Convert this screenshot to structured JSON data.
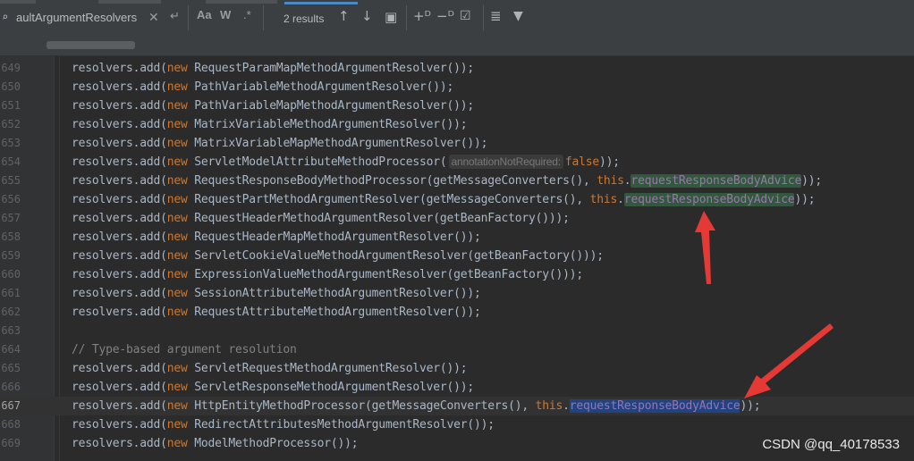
{
  "find": {
    "query": "aultArgumentResolvers",
    "results": "2 results",
    "match_case": "Aa",
    "whole_word": "W",
    "regex": ".*"
  },
  "editor": {
    "lines": [
      {
        "n": "649",
        "parts": [
          [
            "plain",
            "resolvers.add("
          ],
          [
            "kw",
            "new"
          ],
          [
            "plain",
            " RequestParamMapMethodArgumentResolver());"
          ]
        ]
      },
      {
        "n": "650",
        "parts": [
          [
            "plain",
            "resolvers.add("
          ],
          [
            "kw",
            "new"
          ],
          [
            "plain",
            " PathVariableMethodArgumentResolver());"
          ]
        ]
      },
      {
        "n": "651",
        "parts": [
          [
            "plain",
            "resolvers.add("
          ],
          [
            "kw",
            "new"
          ],
          [
            "plain",
            " PathVariableMapMethodArgumentResolver());"
          ]
        ]
      },
      {
        "n": "652",
        "parts": [
          [
            "plain",
            "resolvers.add("
          ],
          [
            "kw",
            "new"
          ],
          [
            "plain",
            " MatrixVariableMethodArgumentResolver());"
          ]
        ]
      },
      {
        "n": "653",
        "parts": [
          [
            "plain",
            "resolvers.add("
          ],
          [
            "kw",
            "new"
          ],
          [
            "plain",
            " MatrixVariableMapMethodArgumentResolver());"
          ]
        ]
      },
      {
        "n": "654",
        "parts": [
          [
            "plain",
            "resolvers.add("
          ],
          [
            "kw",
            "new"
          ],
          [
            "plain",
            " ServletModelAttributeMethodProcessor("
          ],
          [
            "hint",
            "annotationNotRequired:"
          ],
          [
            "kw",
            "false"
          ],
          [
            "plain",
            "));"
          ]
        ]
      },
      {
        "n": "655",
        "parts": [
          [
            "plain",
            "resolvers.add("
          ],
          [
            "kw",
            "new"
          ],
          [
            "plain",
            " RequestResponseBodyMethodProcessor(getMessageConverters(), "
          ],
          [
            "kw",
            "this"
          ],
          [
            "plain",
            "."
          ],
          [
            "fldhl",
            "requestResponseBodyAdvice"
          ],
          [
            "plain",
            "));"
          ]
        ]
      },
      {
        "n": "656",
        "parts": [
          [
            "plain",
            "resolvers.add("
          ],
          [
            "kw",
            "new"
          ],
          [
            "plain",
            " RequestPartMethodArgumentResolver(getMessageConverters(), "
          ],
          [
            "kw",
            "this"
          ],
          [
            "plain",
            "."
          ],
          [
            "fldhl",
            "requestResponseBodyAdvice"
          ],
          [
            "plain",
            "));"
          ]
        ]
      },
      {
        "n": "657",
        "parts": [
          [
            "plain",
            "resolvers.add("
          ],
          [
            "kw",
            "new"
          ],
          [
            "plain",
            " RequestHeaderMethodArgumentResolver(getBeanFactory()));"
          ]
        ]
      },
      {
        "n": "658",
        "parts": [
          [
            "plain",
            "resolvers.add("
          ],
          [
            "kw",
            "new"
          ],
          [
            "plain",
            " RequestHeaderMapMethodArgumentResolver());"
          ]
        ]
      },
      {
        "n": "659",
        "parts": [
          [
            "plain",
            "resolvers.add("
          ],
          [
            "kw",
            "new"
          ],
          [
            "plain",
            " ServletCookieValueMethodArgumentResolver(getBeanFactory()));"
          ]
        ]
      },
      {
        "n": "660",
        "parts": [
          [
            "plain",
            "resolvers.add("
          ],
          [
            "kw",
            "new"
          ],
          [
            "plain",
            " ExpressionValueMethodArgumentResolver(getBeanFactory()));"
          ]
        ]
      },
      {
        "n": "661",
        "parts": [
          [
            "plain",
            "resolvers.add("
          ],
          [
            "kw",
            "new"
          ],
          [
            "plain",
            " SessionAttributeMethodArgumentResolver());"
          ]
        ]
      },
      {
        "n": "662",
        "parts": [
          [
            "plain",
            "resolvers.add("
          ],
          [
            "kw",
            "new"
          ],
          [
            "plain",
            " RequestAttributeMethodArgumentResolver());"
          ]
        ]
      },
      {
        "n": "663",
        "parts": []
      },
      {
        "n": "664",
        "parts": [
          [
            "cmt",
            "// Type-based argument resolution"
          ]
        ]
      },
      {
        "n": "665",
        "parts": [
          [
            "plain",
            "resolvers.add("
          ],
          [
            "kw",
            "new"
          ],
          [
            "plain",
            " ServletRequestMethodArgumentResolver());"
          ]
        ]
      },
      {
        "n": "666",
        "parts": [
          [
            "plain",
            "resolvers.add("
          ],
          [
            "kw",
            "new"
          ],
          [
            "plain",
            " ServletResponseMethodArgumentResolver());"
          ]
        ]
      },
      {
        "n": "667",
        "current": true,
        "parts": [
          [
            "plain",
            "resolvers.add("
          ],
          [
            "kw",
            "new"
          ],
          [
            "plain",
            " HttpEntityMethodProcessor(getMessageConverters(), "
          ],
          [
            "kw",
            "this"
          ],
          [
            "plain",
            "."
          ],
          [
            "fldsel",
            "requestResponseBodyAdvice"
          ],
          [
            "plain",
            "));"
          ]
        ]
      },
      {
        "n": "668",
        "parts": [
          [
            "plain",
            "resolvers.add("
          ],
          [
            "kw",
            "new"
          ],
          [
            "plain",
            " RedirectAttributesMethodArgumentResolver());"
          ]
        ]
      },
      {
        "n": "669",
        "parts": [
          [
            "plain",
            "resolvers.add("
          ],
          [
            "kw",
            "new"
          ],
          [
            "plain",
            " ModelMethodProcessor());"
          ]
        ]
      }
    ]
  },
  "watermark": "CSDN @qq_40178533",
  "colors": {
    "background": "#2b2b2b",
    "keyword": "#cc7832",
    "field": "#9876aa",
    "match_highlight": "#32593d",
    "selection": "#214283",
    "annotation_arrow": "#e53935"
  }
}
